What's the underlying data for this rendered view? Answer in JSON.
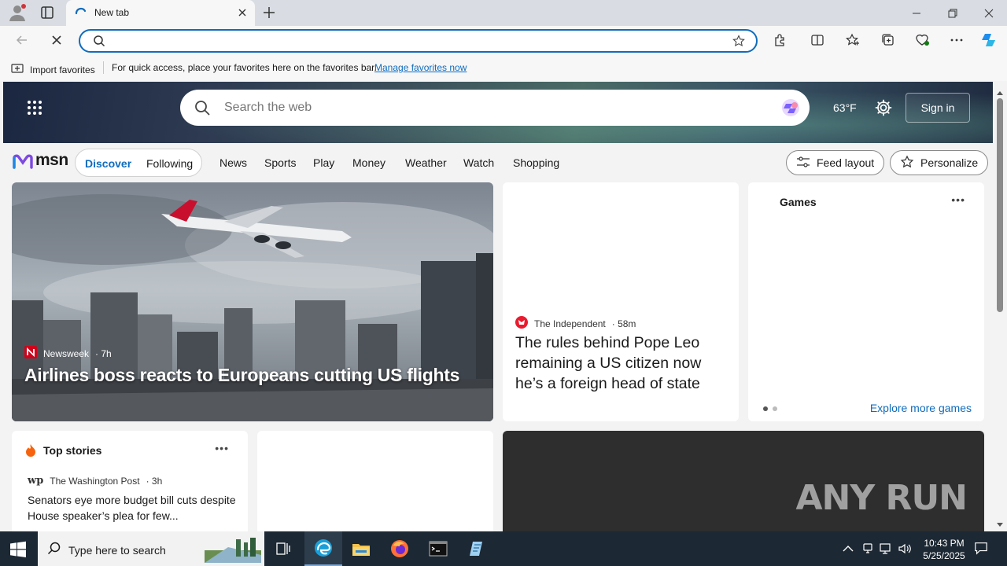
{
  "browser": {
    "tab_title": "New tab",
    "favorites_bar": {
      "import_label": "Import favorites",
      "message": "For quick access, place your favorites here on the favorites bar.",
      "link": "Manage favorites now"
    }
  },
  "msn": {
    "search_placeholder": "Search the web",
    "temperature": "63°F",
    "sign_in": "Sign in",
    "logo_text": "msn",
    "tabs": [
      "Discover",
      "Following"
    ],
    "nav": [
      "News",
      "Sports",
      "Play",
      "Money",
      "Weather",
      "Watch",
      "Shopping"
    ],
    "feed_layout": "Feed layout",
    "personalize": "Personalize"
  },
  "cards": {
    "main": {
      "publisher": "Newsweek",
      "age": "· 7h",
      "headline": "Airlines boss reacts to Europeans cutting US flights"
    },
    "second": {
      "publisher": "The Independent",
      "age": "· 58m",
      "headline": "The rules behind Pope Leo remaining a US citizen now he’s a foreign head of state"
    },
    "games": {
      "title": "Games",
      "explore": "Explore more games"
    },
    "top_stories": {
      "title": "Top stories",
      "publisher": "The Washington Post",
      "age": "· 3h",
      "headline": "Senators eye more budget bill cuts despite House speaker’s plea for few..."
    },
    "watermark": "ANY RUN"
  },
  "taskbar": {
    "search_placeholder": "Type here to search",
    "time": "10:43 PM",
    "date": "5/25/2025"
  },
  "colors": {
    "accent": "#0f6cbd",
    "taskbar": "#1c2833"
  }
}
